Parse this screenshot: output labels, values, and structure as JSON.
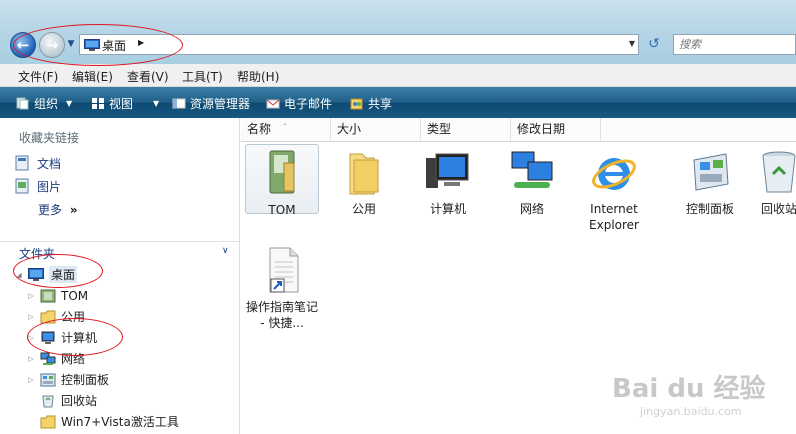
{
  "address_bar": {
    "breadcrumb": "桌面",
    "search_placeholder": "搜索"
  },
  "menu": {
    "items": [
      "文件(F)",
      "编辑(E)",
      "查看(V)",
      "工具(T)",
      "帮助(H)"
    ]
  },
  "command_bar": {
    "organize": "组织",
    "views": "视图",
    "explorer": "资源管理器",
    "email": "电子邮件",
    "share": "共享"
  },
  "nav_pane": {
    "favorites_heading": "收藏夹链接",
    "favorites": [
      "文档",
      "图片"
    ],
    "more": "更多",
    "more_glyph": "»",
    "folders_heading": "文件夹",
    "tree_root": "桌面",
    "tree_items": [
      "TOM",
      "公用",
      "计算机",
      "网络",
      "控制面板",
      "回收站",
      "Win7+Vista激活工具"
    ]
  },
  "columns": [
    "名称",
    "大小",
    "类型",
    "修改日期"
  ],
  "files": [
    {
      "name": "TOM",
      "icon": "user-folder-icon"
    },
    {
      "name": "公用",
      "icon": "folder-icon"
    },
    {
      "name": "计算机",
      "icon": "computer-icon"
    },
    {
      "name": "网络",
      "icon": "network-icon"
    },
    {
      "name": "Internet Explorer",
      "icon": "internet-explorer-icon"
    },
    {
      "name": "控制面板",
      "icon": "control-panel-icon"
    },
    {
      "name": "回收站",
      "icon": "recycle-bin-icon"
    },
    {
      "name": "操作指南笔记 - 快捷...",
      "icon": "shortcut-document-icon"
    }
  ],
  "watermark": {
    "logo": "Bai du 经验",
    "url": "jingyan.baidu.com"
  },
  "colors": {
    "annotation": "#e0141e",
    "command_bar": "#1f5e86",
    "link": "#1a3d80"
  }
}
